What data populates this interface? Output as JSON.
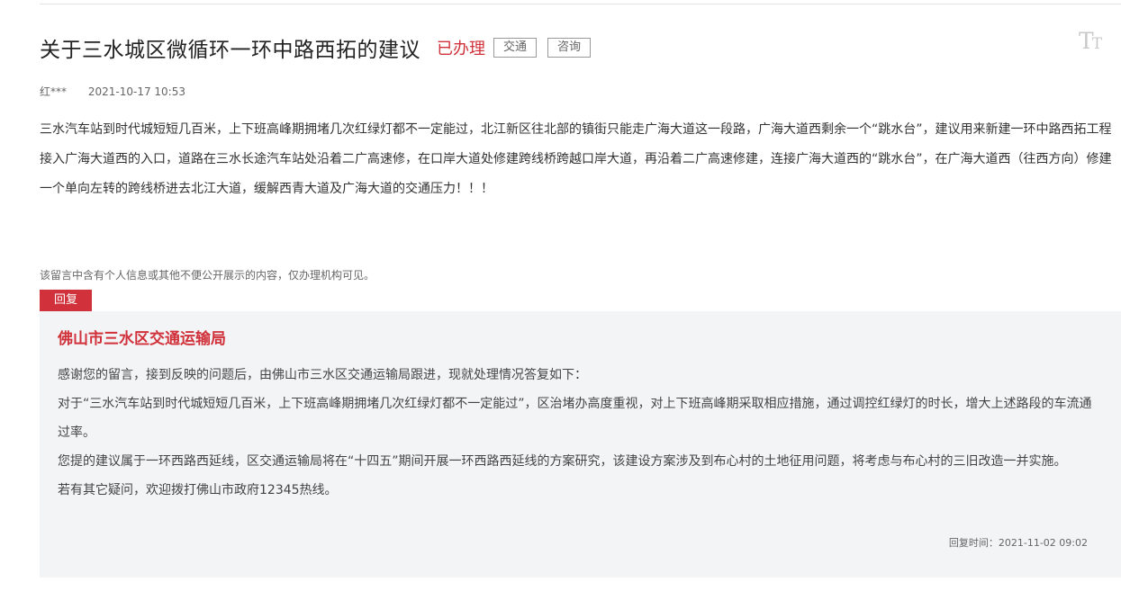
{
  "header": {
    "title": "关于三水城区微循环一环中路西拓的建议",
    "status": "已办理",
    "tags": [
      "交通",
      "咨询"
    ],
    "font_toggle_large": "T",
    "font_toggle_small": "T"
  },
  "meta": {
    "author": "红***",
    "time": "2021-10-17 10:53"
  },
  "message": {
    "content": "三水汽车站到时代城短短几百米，上下班高峰期拥堵几次红绿灯都不一定能过，北江新区往北部的镇街只能走广海大道这一段路，广海大道西剩余一个“跳水台”，建议用来新建一环中路西拓工程接入广海大道西的入口，道路在三水长途汽车站处沿着二广高速修，在口岸大道处修建跨线桥跨越口岸大道，再沿着二广高速修建，连接广海大道西的“跳水台”，在广海大道西（往西方向）修建一个单向左转的跨线桥进去北江大道，缓解西青大道及广海大道的交通压力！！！",
    "privacy_note": "该留言中含有个人信息或其他不便公开展示的内容，仅办理机构可见。"
  },
  "reply": {
    "tab_label": "回复",
    "organization": "佛山市三水区交通运输局",
    "paragraphs": [
      "感谢您的留言，接到反映的问题后，由佛山市三水区交通运输局跟进，现就处理情况答复如下：",
      "对于“三水汽车站到时代城短短几百米，上下班高峰期拥堵几次红绿灯都不一定能过”，区治堵办高度重视，对上下班高峰期采取相应措施，通过调控红绿灯的时长，增大上述路段的车流通过率。",
      "您提的建议属于一环西路西延线，区交通运输局将在“十四五”期间开展一环西路西延线的方案研究，该建设方案涉及到布心村的土地征用问题，将考虑与布心村的三旧改造一并实施。",
      "若有其它疑问，欢迎拨打佛山市政府12345热线。"
    ],
    "time": "回复时间：2021-11-02 09:02"
  },
  "colors": {
    "accent": "#d0313a",
    "reply_background": "#f3f4f6",
    "tag_border": "#999999"
  },
  "icons": {
    "font_size_toggle": "font-size-toggle-icon"
  }
}
